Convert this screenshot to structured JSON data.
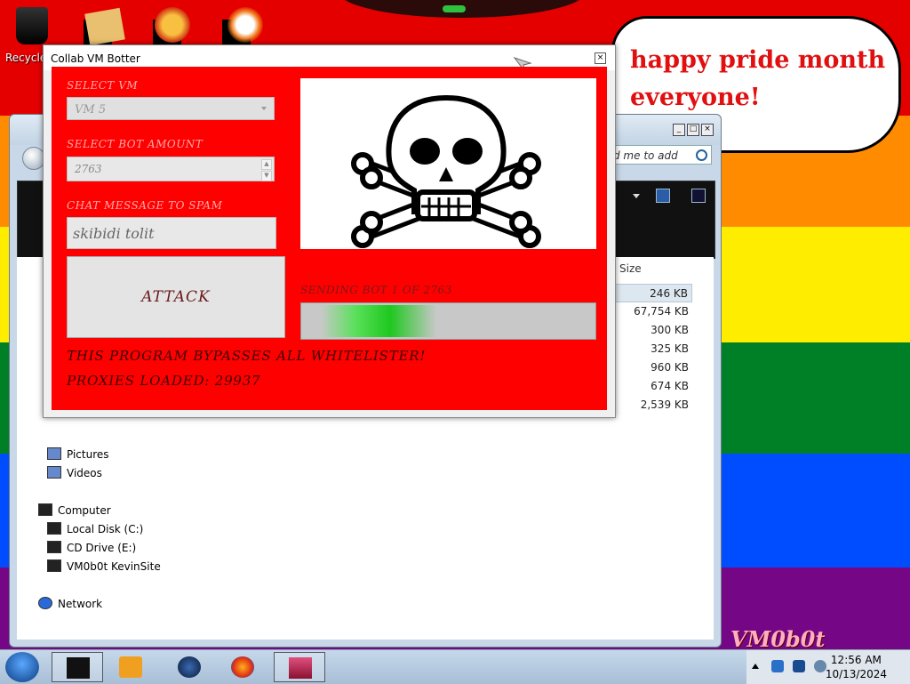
{
  "desktop": {
    "recycle_label": "Recycle",
    "bubble_text": "happy pride month everyone!",
    "logo_text": "VM0b0t"
  },
  "explorer": {
    "search_placeholder": "d me to add",
    "size_header": "Size",
    "sizes": [
      "246 KB",
      "67,754 KB",
      "300 KB",
      "325 KB",
      "960 KB",
      "674 KB",
      "2,539 KB"
    ],
    "nav": {
      "pictures": "Pictures",
      "videos": "Videos",
      "computer": "Computer",
      "local_disk": "Local Disk (C:)",
      "cd_drive": "CD Drive (E:)",
      "vm_share": "VM0b0t KevinSite",
      "network": "Network"
    }
  },
  "botter": {
    "title": "Collab VM Botter",
    "select_vm_label": "SELECT VM",
    "select_vm_value": "VM 5",
    "bot_amount_label": "SELECT BOT AMOUNT",
    "bot_amount_value": "2763",
    "chat_label": "CHAT MESSAGE TO SPAM",
    "chat_value": "skibidi tolit",
    "attack_label": "ATTACK",
    "status_text": "SENDING BOT 1 OF 2763",
    "progress_fraction": 0.42,
    "bypass_text": "THIS PROGRAM BYPASSES ALL WHITELISTER!",
    "proxies_text": "PROXIES LOADED: 29937"
  },
  "taskbar": {
    "time": "12:56 AM",
    "date": "10/13/2024"
  },
  "colors": {
    "botter_bg": "#ff0000",
    "bubble_text": "#e01010",
    "progress_green": "#1ec81e"
  }
}
